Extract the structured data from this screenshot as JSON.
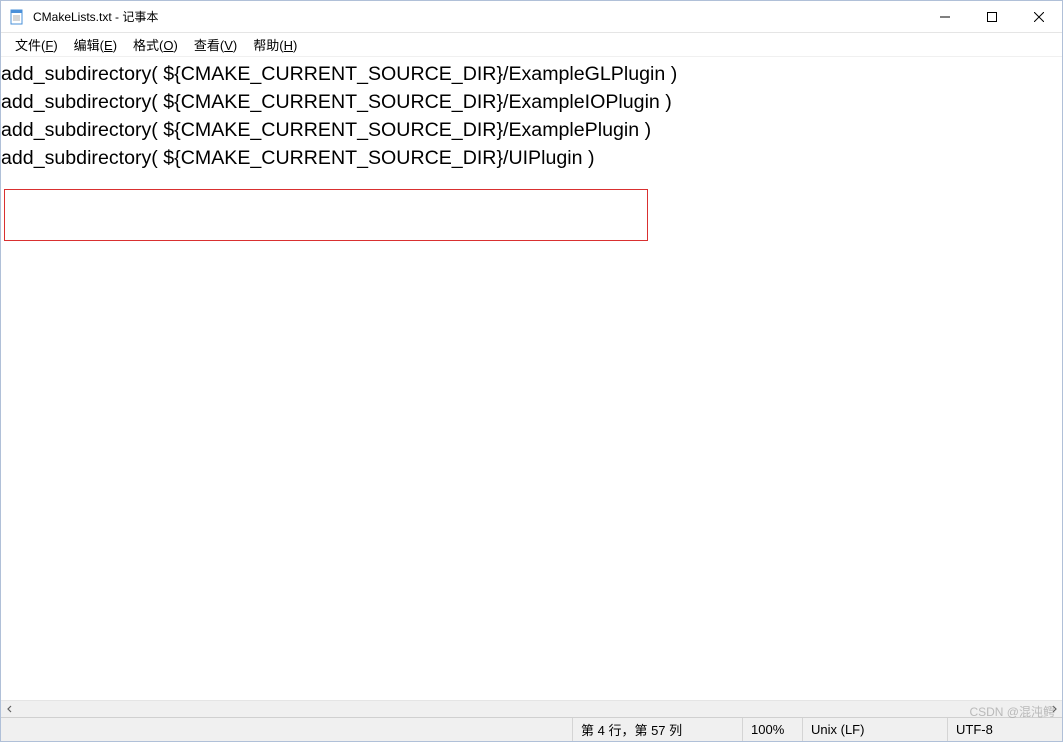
{
  "titlebar": {
    "title": "CMakeLists.txt - 记事本",
    "minimize": "—",
    "maximize": "☐",
    "close": "✕"
  },
  "menubar": {
    "items": [
      {
        "label": "文件",
        "accel": "F"
      },
      {
        "label": "编辑",
        "accel": "E"
      },
      {
        "label": "格式",
        "accel": "O"
      },
      {
        "label": "查看",
        "accel": "V"
      },
      {
        "label": "帮助",
        "accel": "H"
      }
    ]
  },
  "editor": {
    "lines": [
      "add_subdirectory( ${CMAKE_CURRENT_SOURCE_DIR}/ExampleGLPlugin )",
      "add_subdirectory( ${CMAKE_CURRENT_SOURCE_DIR}/ExampleIOPlugin )",
      "add_subdirectory( ${CMAKE_CURRENT_SOURCE_DIR}/ExamplePlugin )",
      "add_subdirectory( ${CMAKE_CURRENT_SOURCE_DIR}/UIPlugin )"
    ]
  },
  "statusbar": {
    "position": "第 4 行，第 57 列",
    "zoom": "100%",
    "eol": "Unix (LF)",
    "encoding": "UTF-8"
  },
  "scroll": {
    "left": "◀",
    "right": "▶"
  },
  "watermark": "CSDN @混沌鳄"
}
